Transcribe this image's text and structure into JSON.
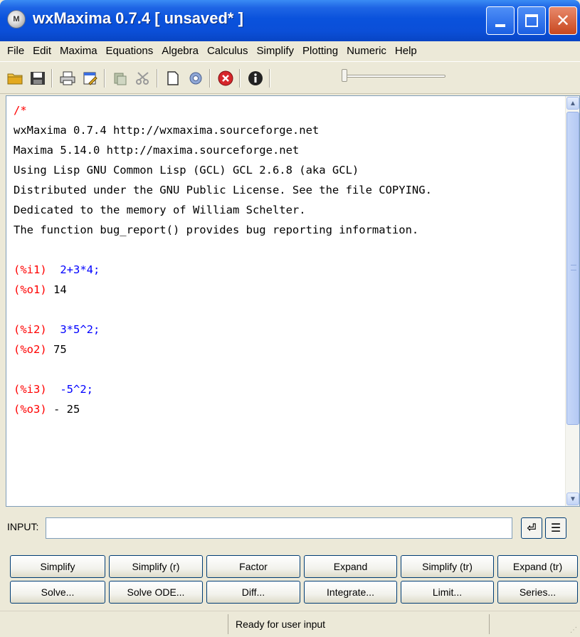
{
  "window": {
    "title": "wxMaxima 0.7.4 [ unsaved* ]",
    "app_icon_glyph": "M",
    "controls": {
      "minimize": "minimize-icon",
      "maximize": "maximize-icon",
      "close": "✕"
    }
  },
  "menu": [
    "File",
    "Edit",
    "Maxima",
    "Equations",
    "Algebra",
    "Calculus",
    "Simplify",
    "Plotting",
    "Numeric",
    "Help"
  ],
  "toolbar": {
    "buttons": [
      "open-folder-icon",
      "save-icon",
      "print-icon",
      "preferences-icon",
      "copy-icon",
      "cut-icon",
      "new-document-icon",
      "settings-gear-icon",
      "interrupt-icon",
      "info-icon"
    ],
    "slider_value": 0
  },
  "console": {
    "header": [
      "/*",
      "wxMaxima 0.7.4 http://wxmaxima.sourceforge.net",
      "Maxima 5.14.0 http://maxima.sourceforge.net",
      "Using Lisp GNU Common Lisp (GCL) GCL 2.6.8 (aka GCL)",
      "Distributed under the GNU Public License. See the file COPYING.",
      "Dedicated to the memory of William Schelter.",
      "The function bug_report() provides bug reporting information."
    ],
    "cells": [
      {
        "in_label": "(%i1)",
        "input": "2+3*4;",
        "out_label": "(%o1)",
        "output": "14"
      },
      {
        "in_label": "(%i2)",
        "input": "3*5^2;",
        "out_label": "(%o2)",
        "output": "75"
      },
      {
        "in_label": "(%i3)",
        "input": "-5^2;",
        "out_label": "(%o3)",
        "output": "- 25"
      }
    ]
  },
  "input": {
    "label": "INPUT:",
    "value": "",
    "enter_glyph": "⏎",
    "multiline_glyph": "☰"
  },
  "buttons_row1": [
    "Simplify",
    "Simplify (r)",
    "Factor",
    "Expand",
    "Simplify (tr)",
    "Expand (tr)"
  ],
  "buttons_row2": [
    "Solve...",
    "Solve ODE...",
    "Diff...",
    "Integrate...",
    "Limit...",
    "Series..."
  ],
  "status": {
    "text": "Ready for user input"
  }
}
